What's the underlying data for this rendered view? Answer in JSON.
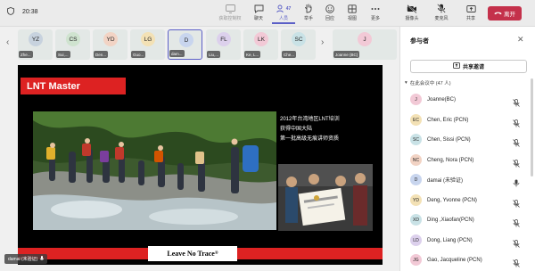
{
  "topbar": {
    "timer": "20:38",
    "buttons": [
      {
        "label": "获取控制权",
        "icon": "control-icon"
      },
      {
        "label": "聊天",
        "icon": "chat-icon"
      },
      {
        "label": "人员",
        "icon": "people-icon",
        "count": "47"
      },
      {
        "label": "举手",
        "icon": "raise-hand-icon"
      },
      {
        "label": "回应",
        "icon": "react-icon"
      },
      {
        "label": "视图",
        "icon": "view-icon"
      },
      {
        "label": "更多",
        "icon": "more-icon"
      },
      {
        "label": "摄像头",
        "icon": "camera-off-icon"
      },
      {
        "label": "麦克风",
        "icon": "mic-off-icon"
      },
      {
        "label": "共享",
        "icon": "share-icon"
      }
    ],
    "leave_label": "离开"
  },
  "gallery": {
    "tiles": [
      {
        "initials": "YZ",
        "name": "Zhe...",
        "color": "#c7d2de"
      },
      {
        "initials": "CS",
        "name": "Sui,...",
        "color": "#cfe3cf"
      },
      {
        "initials": "YD",
        "name": "Den...",
        "color": "#f2d3c4"
      },
      {
        "initials": "LG",
        "name": "Guo...",
        "color": "#f3e1b5"
      },
      {
        "initials": "D",
        "name": "dam...",
        "color": "#c8d5ee"
      },
      {
        "initials": "FL",
        "name": "Liu,...",
        "color": "#dcd0ec"
      },
      {
        "initials": "LK",
        "name": "Ke, L...",
        "color": "#f2c9d6"
      },
      {
        "initials": "SC",
        "name": "Che...",
        "color": "#c9e2e6"
      }
    ],
    "joanne": {
      "initials": "J",
      "name": "Joanne (BC)",
      "color": "#f2c9d6"
    }
  },
  "slide": {
    "title": "LNT Master",
    "caption": [
      "2012年台湾地区LNT培训",
      "获得中国大陆",
      "第一批高级无痕讲师资质"
    ],
    "footer": "Leave No Trace",
    "footer_mark": "®"
  },
  "presenter": "damai (未验证)",
  "panel": {
    "title": "参与者",
    "share_label": "共享邀请",
    "section_label": "在此会议中 (47 人)",
    "participants": [
      {
        "initials": "J",
        "name": "Joanne(BC)",
        "color": "#f2c9d6",
        "muted": true
      },
      {
        "initials": "EC",
        "name": "Chen, Eric (PCN)",
        "color": "#f3e1b5",
        "muted": true
      },
      {
        "initials": "SC",
        "name": "Chen, Sissi (PCN)",
        "color": "#c9e2e6",
        "muted": true
      },
      {
        "initials": "NC",
        "name": "Cheng, Nora (PCN)",
        "color": "#f2d3c4",
        "muted": true
      },
      {
        "initials": "D",
        "name": "damai (未验证)",
        "color": "#c8d5ee",
        "muted": false
      },
      {
        "initials": "YD",
        "name": "Deng, Yvonne (PCN)",
        "color": "#f3e1b5",
        "muted": true
      },
      {
        "initials": "XD",
        "name": "Ding ,Xiaofan(PCN)",
        "color": "#c9e2e6",
        "muted": true
      },
      {
        "initials": "LD",
        "name": "Dong, Liang (PCN)",
        "color": "#dcd0ec",
        "muted": true
      },
      {
        "initials": "JG",
        "name": "Gao, Jacqueline (PCN)",
        "color": "#f2c9d6",
        "muted": true
      }
    ]
  }
}
